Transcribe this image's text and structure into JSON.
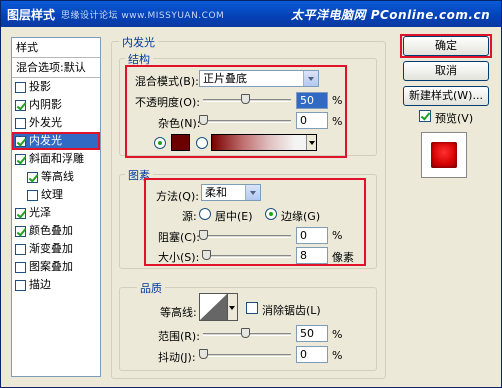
{
  "window": {
    "title": "图层样式",
    "watermark_small": "思缘设计论坛 www.MISSYUAN.COM",
    "watermark_site": "太平洋电脑网",
    "watermark_url": "PConline.com.cn"
  },
  "sidebar": {
    "header": "样式",
    "blend_header": "混合选项:默认",
    "items": [
      {
        "label": "投影",
        "checked": false
      },
      {
        "label": "内阴影",
        "checked": true
      },
      {
        "label": "外发光",
        "checked": false
      },
      {
        "label": "内发光",
        "checked": true,
        "selected": true
      },
      {
        "label": "斜面和浮雕",
        "checked": true
      },
      {
        "label": "等高线",
        "checked": true,
        "indent": true
      },
      {
        "label": "纹理",
        "checked": false,
        "indent": true
      },
      {
        "label": "光泽",
        "checked": true
      },
      {
        "label": "颜色叠加",
        "checked": true
      },
      {
        "label": "渐变叠加",
        "checked": false
      },
      {
        "label": "图案叠加",
        "checked": false
      },
      {
        "label": "描边",
        "checked": false
      }
    ]
  },
  "inner_glow": {
    "group_label": "内发光",
    "structure": {
      "label": "结构",
      "blend_mode_label": "混合模式(B):",
      "blend_mode_value": "正片叠底",
      "opacity_label": "不透明度(O):",
      "opacity_value": "50",
      "opacity_unit": "%",
      "opacity_level": 0.5,
      "noise_label": "杂色(N):",
      "noise_value": "0",
      "noise_unit": "%",
      "noise_level": 0,
      "color": "#6b0000"
    },
    "elements": {
      "label": "图素",
      "method_label": "方法(Q):",
      "method_value": "柔和",
      "source_label": "源:",
      "source_center": "居中(E)",
      "source_edge": "边缘(G)",
      "choke_label": "阻塞(C):",
      "choke_value": "0",
      "choke_unit": "%",
      "choke_level": 0,
      "size_label": "大小(S):",
      "size_value": "8",
      "size_unit": "像素",
      "size_level": 0.03
    },
    "quality": {
      "label": "品质",
      "contour_label": "等高线:",
      "antialias_label": "消除锯齿(L)",
      "range_label": "范围(R):",
      "range_value": "50",
      "range_unit": "%",
      "range_level": 0.5,
      "jitter_label": "抖动(J):",
      "jitter_value": "0",
      "jitter_unit": "%",
      "jitter_level": 0
    }
  },
  "buttons": {
    "ok": "确定",
    "cancel": "取消",
    "new_style": "新建样式(W)...",
    "preview": "预览(V)"
  },
  "colors": {
    "accent_red": "#e0132a",
    "preview_red": "#d40000"
  }
}
